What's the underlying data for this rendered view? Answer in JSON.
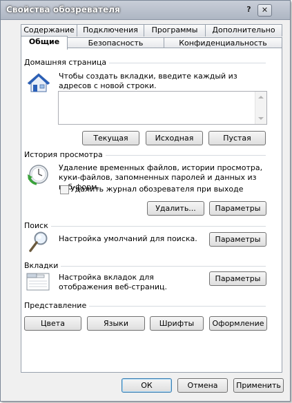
{
  "window": {
    "title": "Свойства обозревателя",
    "help_glyph": "?",
    "close_glyph": "✕"
  },
  "tabs": {
    "row_back": [
      "Содержание",
      "Подключения",
      "Программы",
      "Дополнительно"
    ],
    "row_front": [
      "Общие",
      "Безопасность",
      "Конфиденциальность"
    ],
    "active": "Общие"
  },
  "home": {
    "label": "Домашняя страница",
    "description": "Чтобы создать вкладки, введите каждый из адресов с новой строки.",
    "value": "",
    "buttons": [
      "Текущая",
      "Исходная",
      "Пустая"
    ]
  },
  "history": {
    "label": "История просмотра",
    "description": "Удаление временных файлов, истории просмотра, куки-файлов, запомненных паролей и данных из веб-форм.",
    "checkbox_label": "Удалить журнал обозревателя при выходе",
    "checkbox_checked": false,
    "delete_button": "Удалить...",
    "settings_button": "Параметры"
  },
  "search": {
    "label": "Поиск",
    "description": "Настройка умолчаний для поиска.",
    "settings_button": "Параметры"
  },
  "tabs_section": {
    "label": "Вкладки",
    "description": "Настройка вкладок для отображения веб-страниц.",
    "settings_button": "Параметры"
  },
  "appearance": {
    "label": "Представление",
    "buttons": [
      "Цвета",
      "Языки",
      "Шрифты",
      "Оформление"
    ]
  },
  "footer": {
    "ok": "ОК",
    "cancel": "Отмена",
    "apply": "Применить"
  },
  "colors": {
    "title_text": "#ffffff",
    "default_button_border": "#3c7fb1"
  }
}
